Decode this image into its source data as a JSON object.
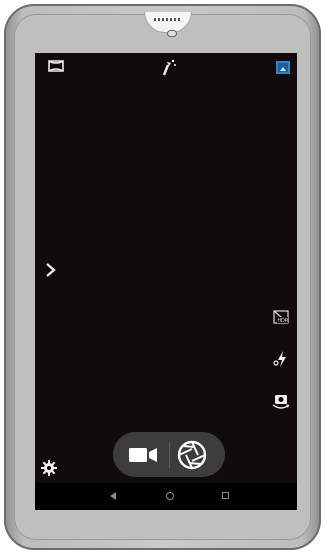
{
  "device": {
    "type": "tablet"
  },
  "camera": {
    "top_bar": {
      "left_icon": "panorama-icon",
      "center_icon": "magic-icon",
      "right_icon": "gallery-icon"
    },
    "left_controls": {
      "expand_icon": "chevron-right-icon",
      "settings_icon": "gear-icon"
    },
    "right_controls": [
      "hdr-icon",
      "flash-auto-icon",
      "switch-camera-icon"
    ],
    "capture_bar": {
      "video_icon": "video-camera-icon",
      "shutter_icon": "shutter-icon"
    }
  },
  "navbar": {
    "back_icon": "back-triangle-icon",
    "home_icon": "home-circle-icon",
    "recent_icon": "recent-square-icon"
  },
  "colors": {
    "screen_bg": "#120b0c",
    "accent_blue": "#2e83c9",
    "capture_bar_bg": "#3c3c3c"
  }
}
